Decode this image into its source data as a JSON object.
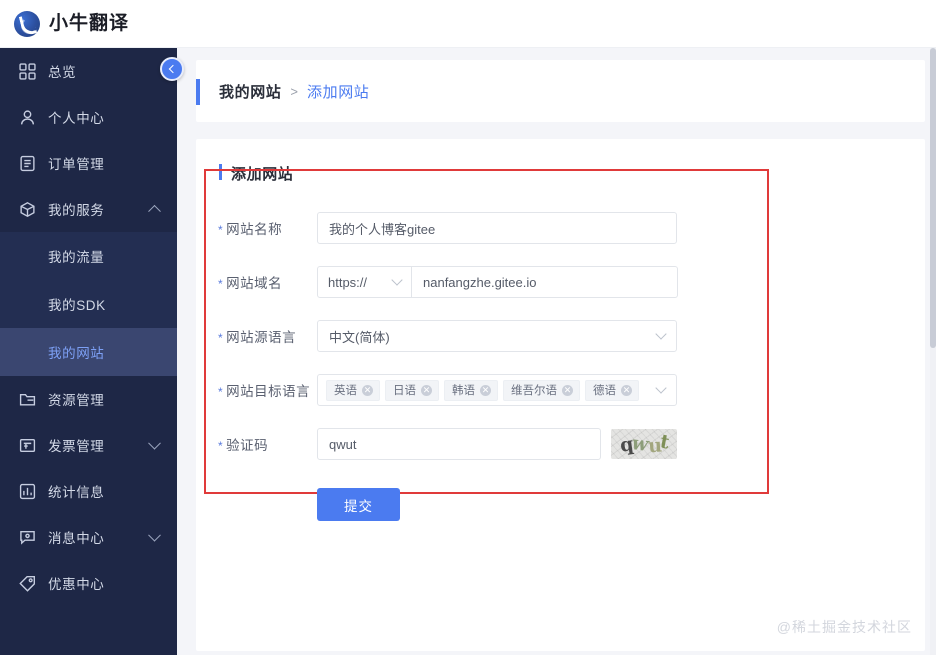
{
  "brand": {
    "name": "小牛翻译",
    "logo_icon": "niutrans-logo-icon"
  },
  "sidebar": {
    "collapse_icon": "chevron-left-icon",
    "items": [
      {
        "label": "总览",
        "icon": "grid-icon",
        "expandable": false
      },
      {
        "label": "个人中心",
        "icon": "user-icon",
        "expandable": false
      },
      {
        "label": "订单管理",
        "icon": "document-list-icon",
        "expandable": false
      },
      {
        "label": "我的服务",
        "icon": "cube-icon",
        "expandable": true,
        "expanded": true
      },
      {
        "label": "资源管理",
        "icon": "folder-icon",
        "expandable": false
      },
      {
        "label": "发票管理",
        "icon": "invoice-icon",
        "expandable": true,
        "expanded": false
      },
      {
        "label": "统计信息",
        "icon": "bar-chart-icon",
        "expandable": false
      },
      {
        "label": "消息中心",
        "icon": "chat-icon",
        "expandable": true,
        "expanded": false
      },
      {
        "label": "优惠中心",
        "icon": "tag-icon",
        "expandable": false
      }
    ],
    "submenu": [
      {
        "label": "我的流量",
        "active": false
      },
      {
        "label": "我的SDK",
        "active": false
      },
      {
        "label": "我的网站",
        "active": true
      }
    ]
  },
  "breadcrumb": {
    "parent": "我的网站",
    "separator": ">",
    "current": "添加网站"
  },
  "form": {
    "title": "添加网站",
    "required_mark": "*",
    "fields": {
      "site_name": {
        "label": "网站名称",
        "value": "我的个人博客gitee",
        "placeholder": ""
      },
      "site_domain": {
        "label": "网站域名",
        "protocol": "https://",
        "protocol_icon": "chevron-down-icon",
        "value": "nanfangzhe.gitee.io",
        "placeholder": ""
      },
      "source_language": {
        "label": "网站源语言",
        "value": "中文(简体)",
        "dropdown_icon": "chevron-down-icon"
      },
      "target_language": {
        "label": "网站目标语言",
        "dropdown_icon": "chevron-down-icon",
        "tags": [
          "英语",
          "日语",
          "韩语",
          "维吾尔语",
          "德语"
        ],
        "tag_close_icon": "close-circle-icon"
      },
      "captcha": {
        "label": "验证码",
        "value": "qwut",
        "placeholder": "",
        "image_text": "qwut",
        "image_icon": "captcha-image"
      }
    },
    "submit_label": "提交"
  },
  "watermark": "@稀土掘金技术社区",
  "colors": {
    "sidebar_bg": "#1e2746",
    "submenu_bg": "#232e52",
    "active_bg": "#3a4670",
    "accent": "#4b7bf0",
    "highlight_border": "#e03a3a",
    "page_bg": "#f4f5f9"
  }
}
